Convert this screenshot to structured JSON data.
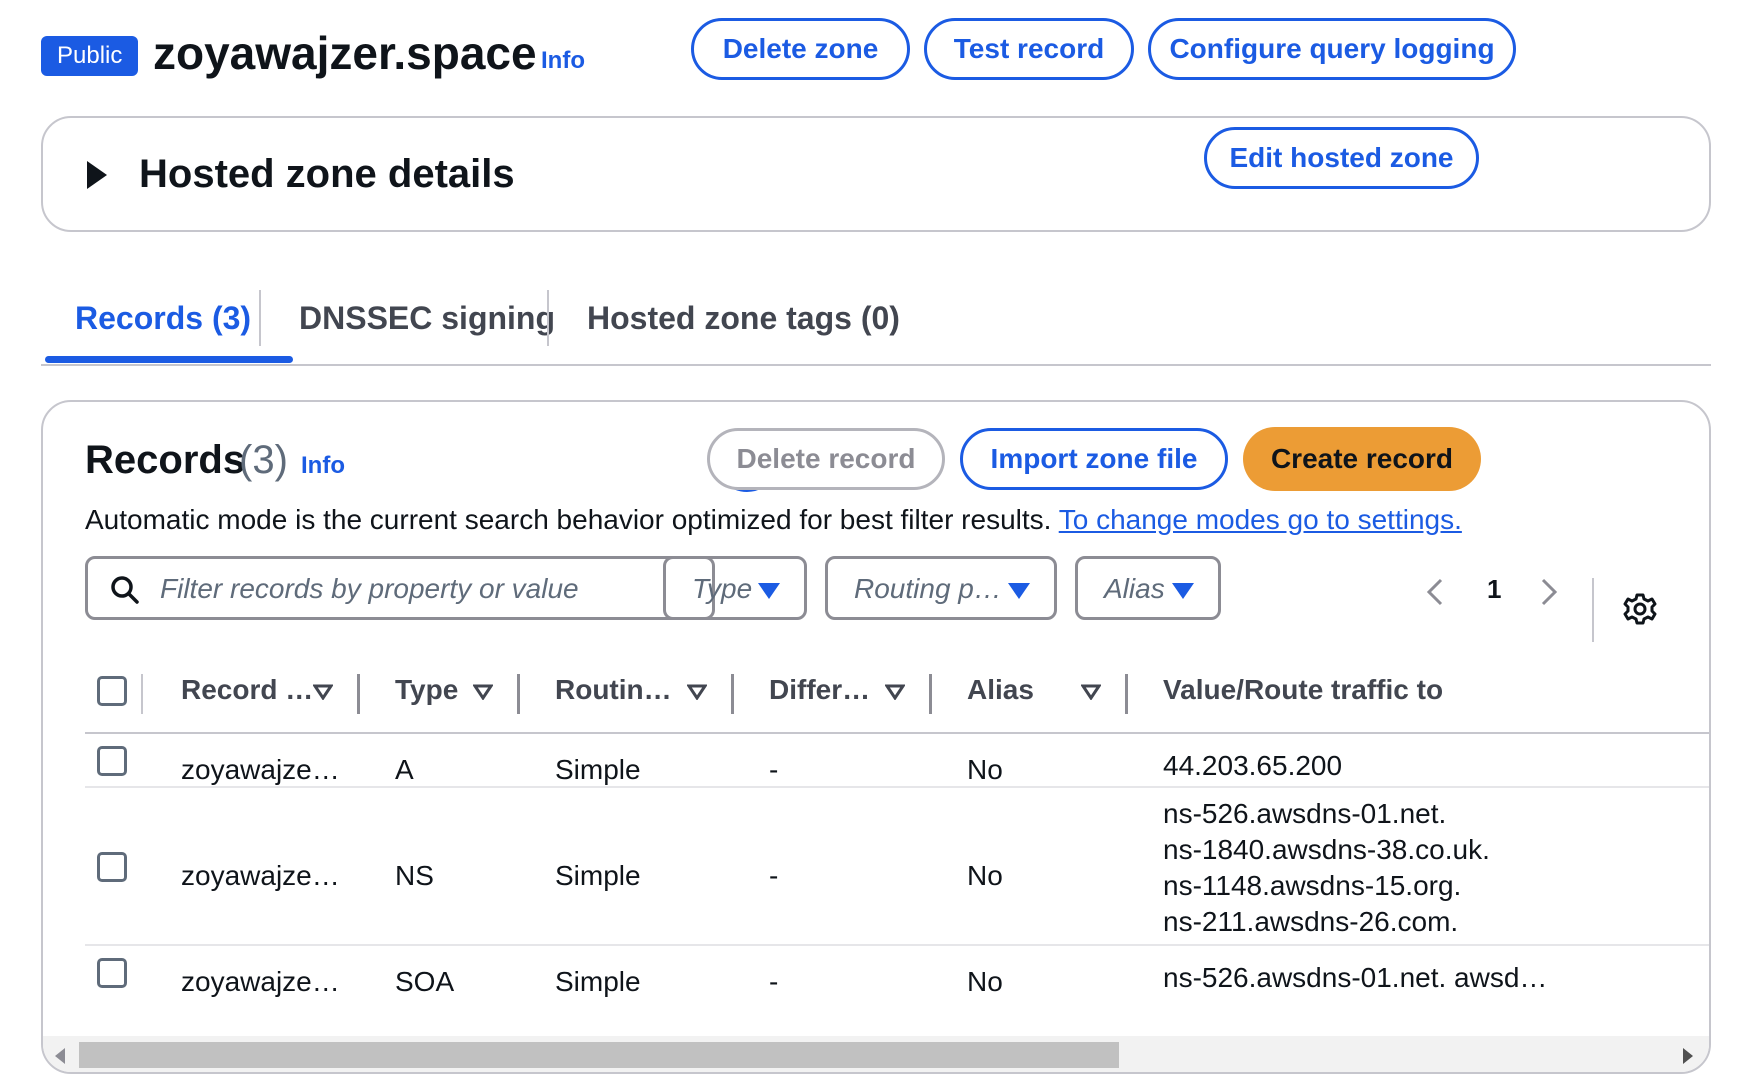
{
  "header": {
    "badge": "Public",
    "title": "zoyawajzer.space",
    "info": "Info",
    "buttons": {
      "delete_zone": "Delete zone",
      "test_record": "Test record",
      "configure_logging": "Configure query logging"
    }
  },
  "details": {
    "title": "Hosted zone details",
    "edit_button": "Edit hosted zone",
    "caret_icon": "caret-right-icon"
  },
  "tabs": [
    {
      "label": "Records (3)",
      "active": true
    },
    {
      "label": "DNSSEC signing",
      "active": false
    },
    {
      "label": "Hosted zone tags (0)",
      "active": false
    }
  ],
  "records": {
    "title": "Records",
    "count": "(3)",
    "info": "Info",
    "refresh_icon": "refresh-icon",
    "delete_button": "Delete record",
    "import_button": "Import zone file",
    "create_button": "Create record",
    "description": "Automatic mode is the current search behavior optimized for best filter results.",
    "settings_link": "To change modes go to settings.",
    "search_placeholder": "Filter records by property or value",
    "filters": {
      "type": "Type",
      "routing": "Routing p…",
      "alias": "Alias"
    },
    "page": "1",
    "columns": [
      "Record …",
      "Type",
      "Routin…",
      "Differ…",
      "Alias",
      "Value/Route traffic to"
    ],
    "rows": [
      {
        "name": "zoyawajze…",
        "type": "A",
        "routing": "Simple",
        "differ": "-",
        "alias": "No",
        "values": [
          "44.203.65.200"
        ]
      },
      {
        "name": "zoyawajze…",
        "type": "NS",
        "routing": "Simple",
        "differ": "-",
        "alias": "No",
        "values": [
          "ns-526.awsdns-01.net.",
          "ns-1840.awsdns-38.co.uk.",
          "ns-1148.awsdns-15.org.",
          "ns-211.awsdns-26.com."
        ]
      },
      {
        "name": "zoyawajze…",
        "type": "SOA",
        "routing": "Simple",
        "differ": "-",
        "alias": "No",
        "values": [
          "ns-526.awsdns-01.net. awsd…"
        ]
      }
    ]
  },
  "colors": {
    "accent": "#1b5be3",
    "primary_button": "#ec9c35",
    "border": "#c6c6cd"
  }
}
